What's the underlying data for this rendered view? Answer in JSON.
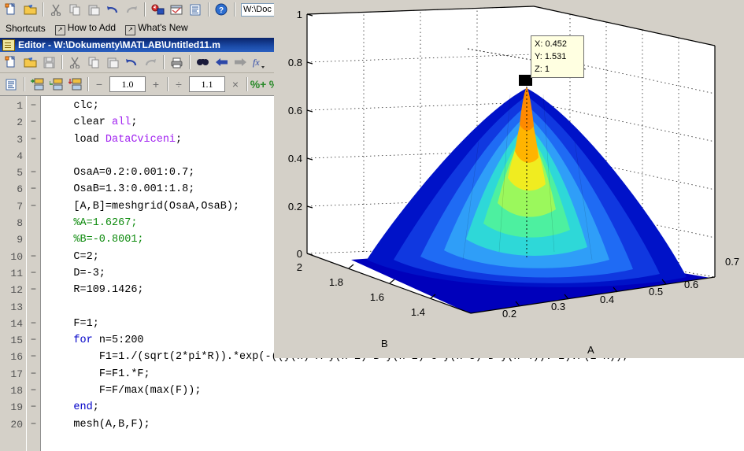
{
  "desktop": {
    "toolbar": {
      "icons": [
        {
          "name": "new-file-icon",
          "glyph": "🗋"
        },
        {
          "name": "open-folder-icon",
          "glyph": "📂"
        },
        {
          "name": "cut-icon",
          "glyph": "✂"
        },
        {
          "name": "copy-icon",
          "glyph": "⧉"
        },
        {
          "name": "paste-icon",
          "glyph": "📋"
        },
        {
          "name": "undo-icon",
          "glyph": "↺"
        },
        {
          "name": "redo-icon",
          "glyph": "↻"
        },
        {
          "name": "simulink-icon",
          "glyph": "⊕"
        },
        {
          "name": "guide-icon",
          "glyph": "▤"
        },
        {
          "name": "profiler-icon",
          "glyph": "▤"
        },
        {
          "name": "help-icon",
          "glyph": "?"
        }
      ],
      "current_folder": "W:\\Doc"
    },
    "shortcuts_bar": {
      "label": "Shortcuts",
      "items": [
        {
          "label": "How to Add"
        },
        {
          "label": "What's New"
        }
      ]
    }
  },
  "editor": {
    "title": "Editor - W:\\Dokumenty\\MATLAB\\Untitled11.m",
    "toolbar1": [
      {
        "name": "new-file-icon",
        "glyph": "🗋"
      },
      {
        "name": "open-file-icon",
        "glyph": "📂"
      },
      {
        "name": "save-icon",
        "glyph": "💾"
      },
      {
        "name": "cut-icon",
        "glyph": "✂"
      },
      {
        "name": "copy-icon",
        "glyph": "⧉"
      },
      {
        "name": "paste-icon",
        "glyph": "📋"
      },
      {
        "name": "undo-icon",
        "glyph": "↺"
      },
      {
        "name": "redo-icon",
        "glyph": "↻"
      },
      {
        "name": "print-icon",
        "glyph": "🖨"
      },
      {
        "name": "find-icon",
        "glyph": "🔍"
      },
      {
        "name": "back-arrow-icon",
        "glyph": "←"
      },
      {
        "name": "forward-arrow-icon",
        "glyph": "→"
      },
      {
        "name": "function-browser-icon",
        "glyph": "fx"
      }
    ],
    "toolbar2": {
      "icons": [
        {
          "name": "show-functions-icon",
          "glyph": "▤"
        },
        {
          "name": "insert-cell-icon",
          "glyph": "▤"
        },
        {
          "name": "insert-cell-divider-icon",
          "glyph": "▤"
        },
        {
          "name": "insert-cell-below-icon",
          "glyph": "▤"
        }
      ],
      "minus_label": "−",
      "value_add": "1.0",
      "plus_label": "+",
      "divide_label": "÷",
      "value_mul": "1.1",
      "times_label": "×",
      "percent_plus_label": "%+",
      "percent_label": "%"
    },
    "code": {
      "lines": [
        {
          "n": "1",
          "bp": "−",
          "tokens": [
            {
              "t": "clc;",
              "c": ""
            }
          ],
          "indent": 4
        },
        {
          "n": "2",
          "bp": "−",
          "tokens": [
            {
              "t": "clear ",
              "c": ""
            },
            {
              "t": "all",
              "c": "str"
            },
            {
              "t": ";",
              "c": ""
            }
          ],
          "indent": 4
        },
        {
          "n": "3",
          "bp": "−",
          "tokens": [
            {
              "t": "load ",
              "c": ""
            },
            {
              "t": "DataCviceni",
              "c": "str"
            },
            {
              "t": ";",
              "c": ""
            }
          ],
          "indent": 4
        },
        {
          "n": "4",
          "bp": "",
          "tokens": [],
          "indent": 0
        },
        {
          "n": "5",
          "bp": "−",
          "tokens": [
            {
              "t": "OsaA=0.2:0.001:0.7;",
              "c": ""
            }
          ],
          "indent": 4
        },
        {
          "n": "6",
          "bp": "−",
          "tokens": [
            {
              "t": "OsaB=1.3:0.001:1.8;",
              "c": ""
            }
          ],
          "indent": 4
        },
        {
          "n": "7",
          "bp": "−",
          "tokens": [
            {
              "t": "[A,B]=meshgrid(OsaA,OsaB);",
              "c": ""
            }
          ],
          "indent": 4
        },
        {
          "n": "8",
          "bp": "",
          "tokens": [
            {
              "t": "%A=1.6267;",
              "c": "cmt"
            }
          ],
          "indent": 4
        },
        {
          "n": "9",
          "bp": "",
          "tokens": [
            {
              "t": "%B=-0.8001;",
              "c": "cmt"
            }
          ],
          "indent": 4
        },
        {
          "n": "10",
          "bp": "−",
          "tokens": [
            {
              "t": "C=2;",
              "c": ""
            }
          ],
          "indent": 4
        },
        {
          "n": "11",
          "bp": "−",
          "tokens": [
            {
              "t": "D=-3;",
              "c": ""
            }
          ],
          "indent": 4
        },
        {
          "n": "12",
          "bp": "−",
          "tokens": [
            {
              "t": "R=109.1426;",
              "c": ""
            }
          ],
          "indent": 4
        },
        {
          "n": "13",
          "bp": "",
          "tokens": [],
          "indent": 0
        },
        {
          "n": "14",
          "bp": "−",
          "tokens": [
            {
              "t": "F=1;",
              "c": ""
            }
          ],
          "indent": 4
        },
        {
          "n": "15",
          "bp": "−",
          "tokens": [
            {
              "t": "for",
              "c": "kw"
            },
            {
              "t": " n=5:200",
              "c": ""
            }
          ],
          "indent": 4
        },
        {
          "n": "16",
          "bp": "−",
          "tokens": [
            {
              "t": "F1=1./(sqrt(2*pi*R)).*exp(-((y(n)-A*y(n-1)-B*y(n-2)-C*y(n-3)-D*y(n-4)).^2)./(2*R));",
              "c": ""
            }
          ],
          "indent": 8
        },
        {
          "n": "17",
          "bp": "−",
          "tokens": [
            {
              "t": "F=F1.*F;",
              "c": ""
            }
          ],
          "indent": 8
        },
        {
          "n": "18",
          "bp": "−",
          "tokens": [
            {
              "t": "F=F/max(max(F));",
              "c": ""
            }
          ],
          "indent": 8
        },
        {
          "n": "19",
          "bp": "−",
          "tokens": [
            {
              "t": "end",
              "c": "kw"
            },
            {
              "t": ";",
              "c": ""
            }
          ],
          "indent": 4
        },
        {
          "n": "20",
          "bp": "−",
          "tokens": [
            {
              "t": "mesh(A,B,F);",
              "c": ""
            }
          ],
          "indent": 4
        }
      ]
    }
  },
  "figure": {
    "datatip": {
      "x_label": "X: 0.452",
      "y_label": "Y: 1.531",
      "z_label": "Z: 1"
    },
    "colors": {
      "background": "#d4d0c8",
      "axes_bg": "#ffffff",
      "peak": "#ff9000",
      "floor": "#0000bb"
    }
  },
  "chart_data": {
    "type": "surface",
    "title": "",
    "xlabel": "A",
    "ylabel": "B",
    "zlabel": "",
    "xlim": [
      0.2,
      0.7
    ],
    "ylim": [
      1.3,
      2.0
    ],
    "zlim": [
      0,
      1
    ],
    "xticks": [
      "0.2",
      "0.3",
      "0.4",
      "0.5",
      "0.6",
      "0.7"
    ],
    "yticks": [
      "2",
      "1.8",
      "1.6",
      "1.4"
    ],
    "zticks": [
      "0",
      "0.2",
      "0.4",
      "0.6",
      "0.8",
      "1"
    ],
    "grid": true,
    "colormap": "jet",
    "legend": "none",
    "annotations": [
      {
        "type": "datatip",
        "x": 0.452,
        "y": 1.531,
        "z": 1,
        "text": "X: 0.452 / Y: 1.531 / Z: 1"
      }
    ],
    "peak": {
      "x": 0.452,
      "y": 1.531,
      "z": 1
    },
    "description": "3D mesh surface of a normalized 2-D Gaussian likelihood over parameters A and B, peak value 1 at A=0.452, B=1.531."
  }
}
